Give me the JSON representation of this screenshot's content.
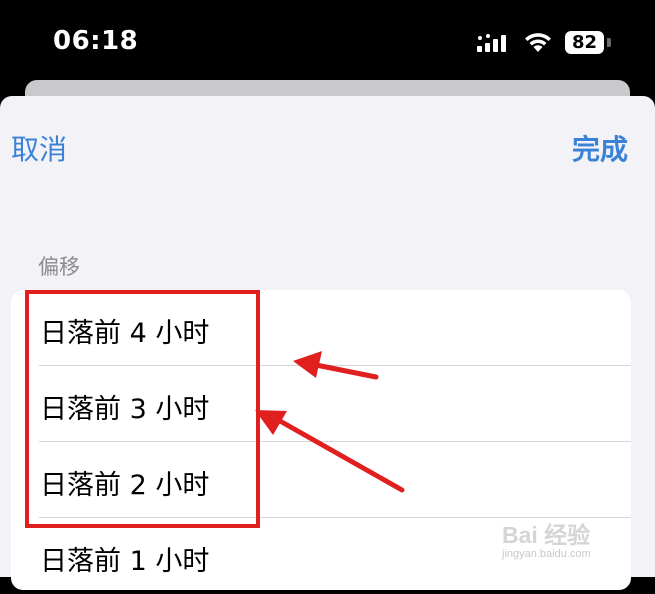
{
  "status_bar": {
    "time": "06:18",
    "battery": "82"
  },
  "nav": {
    "cancel_label": "取消",
    "done_label": "完成"
  },
  "section_header": "偏移",
  "rows": [
    {
      "label": "日落前 4 小时"
    },
    {
      "label": "日落前 3 小时"
    },
    {
      "label": "日落前 2 小时"
    },
    {
      "label": "日落前 1 小时"
    }
  ],
  "annotation": {
    "color": "#e01f1f"
  },
  "watermark": {
    "logo": "Bai 经验",
    "url": "jingyan.baidu.com"
  },
  "colors": {
    "accent": "#3b82d6",
    "background": "#f2f2f7"
  }
}
